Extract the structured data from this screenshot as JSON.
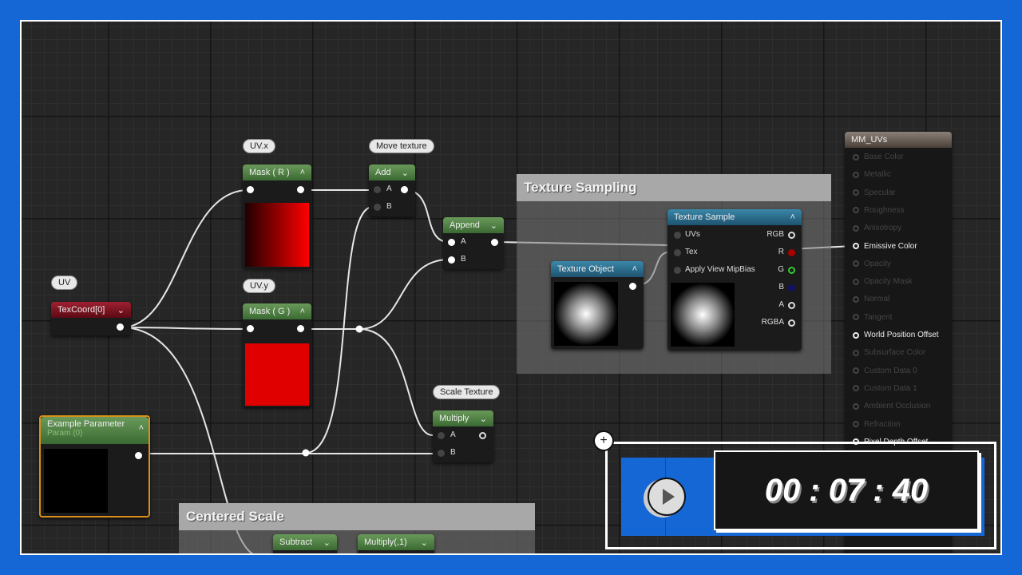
{
  "nodes": {
    "texcoord": {
      "comment": "UV",
      "title": "TexCoord[0]"
    },
    "mask_r": {
      "comment": "UV.x",
      "title": "Mask ( R )"
    },
    "mask_g": {
      "comment": "UV.y",
      "title": "Mask ( G )"
    },
    "add": {
      "comment": "Move texture",
      "title": "Add",
      "pin_a": "A",
      "pin_b": "B"
    },
    "append": {
      "title": "Append",
      "pin_a": "A",
      "pin_b": "B"
    },
    "texture_object": {
      "title": "Texture Object"
    },
    "texture_sample": {
      "title": "Texture Sample",
      "inputs": [
        "UVs",
        "Tex",
        "Apply View MipBias"
      ],
      "outputs": [
        "RGB",
        "R",
        "G",
        "B",
        "A",
        "RGBA"
      ]
    },
    "example_param": {
      "title": "Example Parameter",
      "subtitle": "Param (0)"
    },
    "multiply": {
      "comment": "Scale Texture",
      "title": "Multiply",
      "pin_a": "A",
      "pin_b": "B"
    },
    "subtract": {
      "title": "Subtract"
    },
    "multiply1": {
      "title": "Multiply(,1)"
    }
  },
  "comments": {
    "texture_sampling": "Texture Sampling",
    "centered_scale": "Centered Scale"
  },
  "material": {
    "title": "MM_UVs",
    "inputs": [
      {
        "label": "Base Color",
        "active": false
      },
      {
        "label": "Metallic",
        "active": false
      },
      {
        "label": "Specular",
        "active": false
      },
      {
        "label": "Roughness",
        "active": false
      },
      {
        "label": "Anisotropy",
        "active": false
      },
      {
        "label": "Emissive Color",
        "active": true
      },
      {
        "label": "Opacity",
        "active": false
      },
      {
        "label": "Opacity Mask",
        "active": false
      },
      {
        "label": "Normal",
        "active": false
      },
      {
        "label": "Tangent",
        "active": false
      },
      {
        "label": "World Position Offset",
        "active": true
      },
      {
        "label": "Subsurface Color",
        "active": false
      },
      {
        "label": "Custom Data 0",
        "active": false
      },
      {
        "label": "Custom Data 1",
        "active": false
      },
      {
        "label": "Ambient Occlusion",
        "active": false
      },
      {
        "label": "Refraction",
        "active": false
      },
      {
        "label": "Pixel Depth Offset",
        "active": true
      }
    ]
  },
  "timer": {
    "value": "00 : 07 : 40",
    "add_icon": "plus-icon",
    "play_icon": "play-icon"
  },
  "colors": {
    "frame": "#1667d6",
    "green_header": "#4d7d42",
    "red_header": "#8a1525",
    "blue_header": "#2f7597"
  }
}
